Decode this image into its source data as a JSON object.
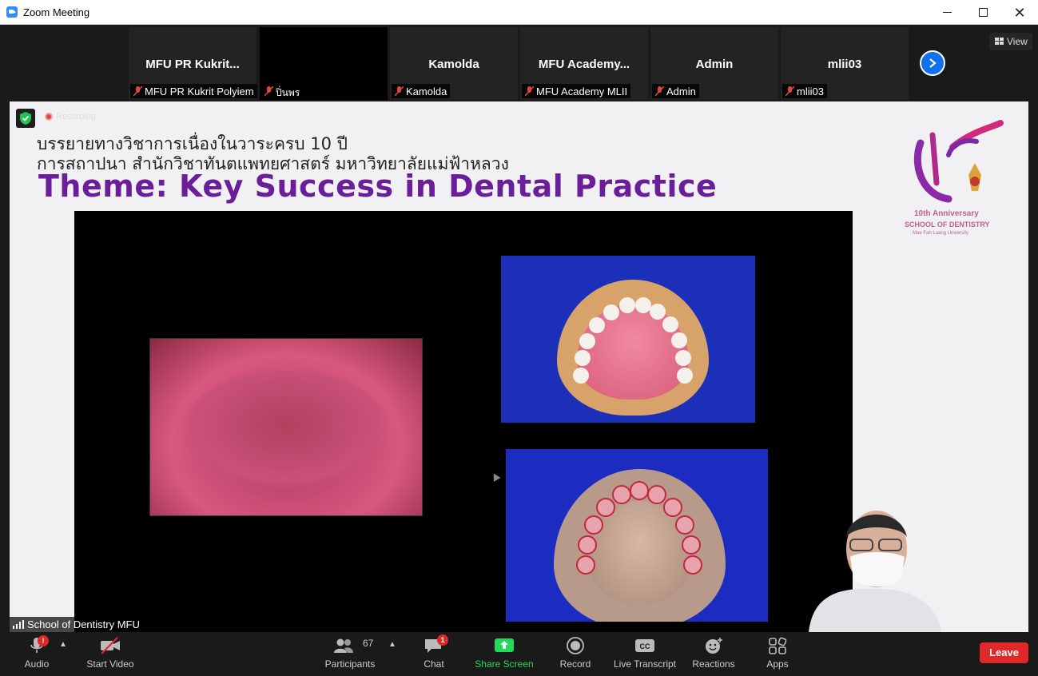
{
  "window": {
    "title": "Zoom Meeting"
  },
  "gallery": {
    "tiles": [
      {
        "name": "MFU PR Kukrit...",
        "label": "MFU PR Kukrit Polyiem"
      },
      {
        "name": "",
        "label": "ปิ่นพร"
      },
      {
        "name": "Kamolda",
        "label": "Kamolda"
      },
      {
        "name": "MFU Academy...",
        "label": "MFU Academy MLII"
      },
      {
        "name": "Admin",
        "label": "Admin"
      },
      {
        "name": "mlii03",
        "label": "mlii03"
      }
    ],
    "view_label": "View"
  },
  "share": {
    "recording_label": "Recording",
    "thai_line1": "บรรยายทางวิชาการเนื่องในวาระครบ 10 ปี",
    "thai_line2": "การสถาปนา สำนักวิชาทันตแพทยศาสตร์ มหาวิทยาลัยแม่ฟ้าหลวง",
    "theme": "Theme: Key Success in Dental Practice",
    "logo": {
      "anniversary": "10th Anniversary",
      "school": "SCHOOL OF DENTISTRY",
      "university": "Mae Fah Luang University"
    },
    "host_label": "School of Dentistry MFU"
  },
  "toolbar": {
    "audio": {
      "label": "Audio",
      "badge": "!"
    },
    "video": {
      "label": "Start Video"
    },
    "participants": {
      "label": "Participants",
      "count": "67"
    },
    "chat": {
      "label": "Chat",
      "badge": "1"
    },
    "share": {
      "label": "Share Screen"
    },
    "record": {
      "label": "Record"
    },
    "transcript": {
      "label": "Live Transcript",
      "icon_text": "CC"
    },
    "reactions": {
      "label": "Reactions"
    },
    "apps": {
      "label": "Apps"
    },
    "leave": {
      "label": "Leave"
    }
  },
  "colors": {
    "accent": "#0e72ed",
    "share_green": "#23d959",
    "leave_red": "#e02828",
    "theme_purple": "#6b1e9a"
  }
}
